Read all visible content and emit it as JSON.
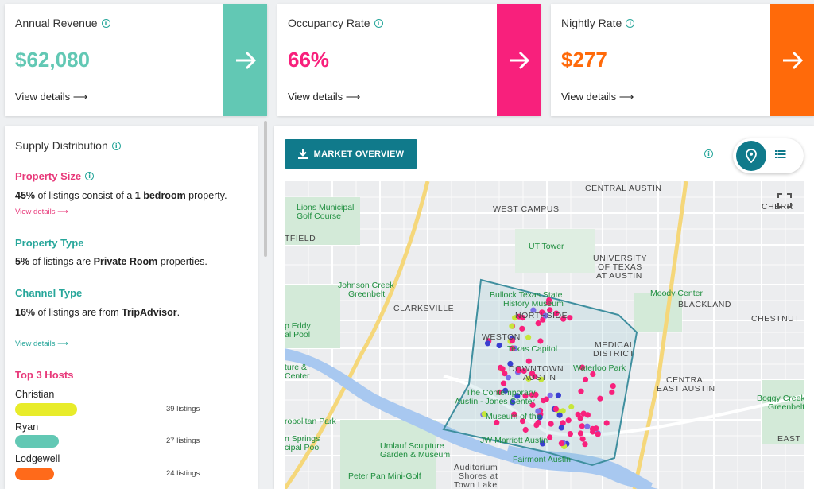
{
  "cards": [
    {
      "label": "Annual Revenue",
      "value": "$62,080",
      "details": "View details ⟶",
      "color": "#62c8b4",
      "value_color": "#62c8b4"
    },
    {
      "label": "Occupancy Rate",
      "value": "66%",
      "details": "View details ⟶",
      "color": "#f8207c",
      "value_color": "#f8207c"
    },
    {
      "label": "Nightly Rate",
      "value": "$277",
      "details": "View details ⟶",
      "color": "#ff6a0a",
      "value_color": "#ff6a0a"
    }
  ],
  "supply": {
    "title": "Supply Distribution",
    "property_size": {
      "title": "Property Size",
      "pct": "45%",
      "text1": " of listings consist of a ",
      "bold": "1 bedroom",
      "text2": " property.",
      "link": "View details ⟶",
      "color": "#e8397a"
    },
    "property_type": {
      "title": "Property Type",
      "pct": "5%",
      "text1": " of listings are ",
      "bold": "Private Room",
      "text2": " properties.",
      "color": "#26a69a"
    },
    "channel_type": {
      "title": "Channel Type",
      "pct": "16%",
      "text1": " of listings are from ",
      "bold": "TripAdvisor",
      "text2": ".",
      "link": "View details ⟶",
      "color": "#26a69a"
    },
    "hosts": {
      "title": "Top 3 Hosts",
      "items": [
        {
          "name": "Christian",
          "count": "39 listings",
          "color": "#e8ec2a",
          "share": 0.39
        },
        {
          "name": "Ryan",
          "count": "27 listings",
          "color": "#62c8b4",
          "share": 0.27
        },
        {
          "name": "Lodgewell",
          "count": "24 listings",
          "count_suffix": "",
          "color": "#ff6a1a",
          "share": 0.24
        }
      ]
    }
  },
  "map_panel": {
    "button_label": "MARKET OVERVIEW",
    "labels": {
      "central_austin": "CENTRAL AUSTIN",
      "cherr": "CHERR",
      "west_campus": "WEST CAMPUS",
      "tfield": "TFIELD",
      "ut_tower": "UT Tower",
      "university": "UNIVERSITY",
      "of_texas": "OF TEXAS",
      "at_austin": "AT AUSTIN",
      "lions": "Lions Municipal",
      "golf": "Golf Course",
      "johnson": "Johnson Creek",
      "greenbelt": "Greenbelt",
      "clarksville": "CLARKSVILLE",
      "bullock": "Bullock Texas State",
      "history": "History Museum",
      "northside": "NORTHSIDE",
      "moody": "Moody Center",
      "blackland": "BLACKLAND",
      "chestnut": "CHESTNUT",
      "eddy": "p Eddy",
      "al_pool": "al Pool",
      "weston": "WESTON",
      "capitol": "Texas Capitol",
      "medical": "MEDICAL",
      "district": "DISTRICT",
      "downtown": "DOWNTOWN",
      "austin": "AUSTIN",
      "waterloo": "Waterloo Park",
      "ture": "ture &",
      "center": "Center",
      "central": "CENTRAL",
      "east_austin": "EAST AUSTIN",
      "contemporary": "The Contemporary",
      "jones": "Austin - Jones Center",
      "boggy": "Boggy Creek",
      "boggy2": "Greenbelt",
      "politan": "ropolitan Park",
      "museum": "Museum of the",
      "springs": "n Springs",
      "cipal": "cipal Pool",
      "umlauf": "Umlauf Sculpture",
      "garden": "Garden & Museum",
      "jw": "JW Marriott Austin",
      "fairmont": "Fairmont Austin",
      "east": "EAST",
      "peter_pan": "Peter Pan Mini-Golf",
      "auditorium": "Auditorium",
      "shores": "Shores at",
      "town_lake": "Town Lake"
    }
  }
}
